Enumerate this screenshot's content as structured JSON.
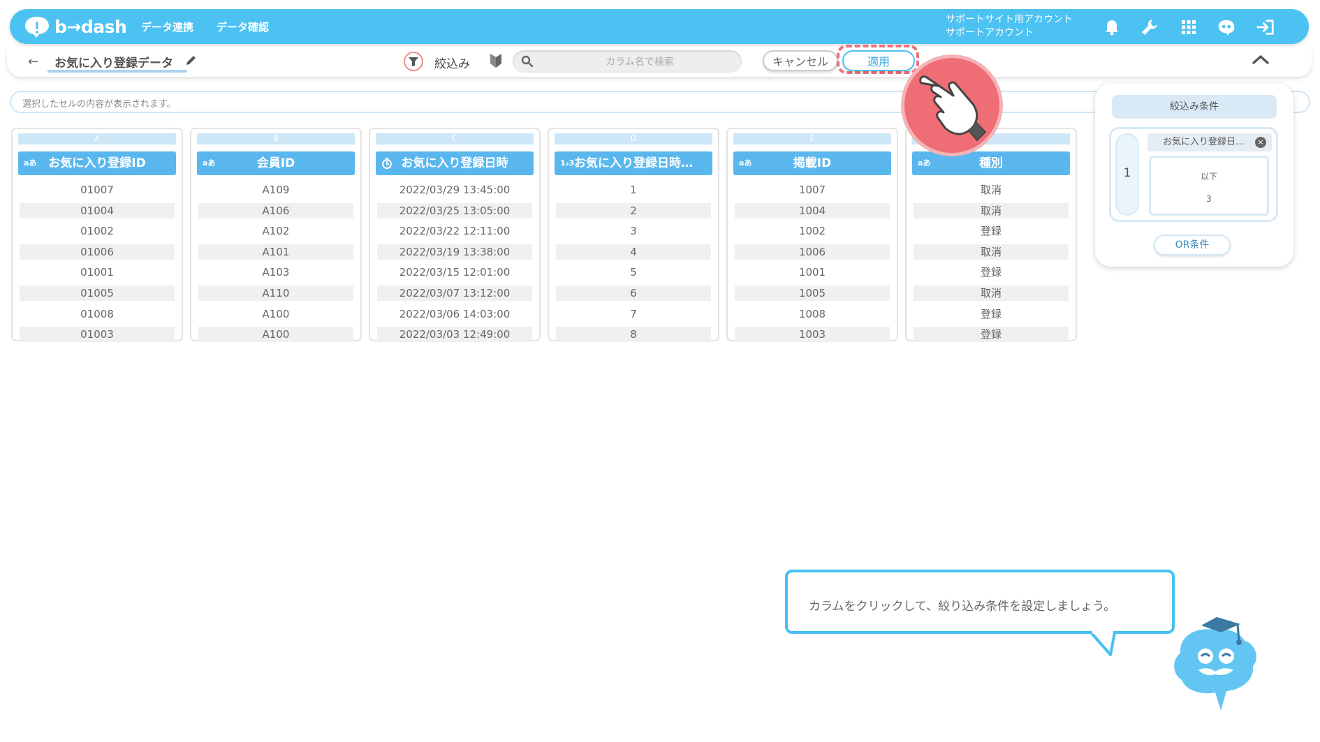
{
  "app": {
    "logo_text": "b→dash",
    "nav": [
      "データ連携",
      "データ確認"
    ],
    "account": {
      "line1": "サポートサイト用アカウント",
      "line2": "サポートアカウント"
    }
  },
  "toolbar": {
    "back_label": "←",
    "datasource_name": "お気に入り登録データ",
    "filter_label": "絞込み",
    "search_placeholder": "カラム名で検索",
    "cancel_label": "キャンセル",
    "apply_label": "適用"
  },
  "cell_bar": {
    "placeholder": "選択したセルの内容が表示されます。"
  },
  "table": {
    "columns": [
      {
        "letter": "A",
        "type": "aあ",
        "name": "お気に入り登録ID",
        "cells": [
          "01007",
          "01004",
          "01002",
          "01006",
          "01001",
          "01005",
          "01008",
          "01003"
        ]
      },
      {
        "letter": "B",
        "type": "aあ",
        "name": "会員ID",
        "cells": [
          "A109",
          "A106",
          "A102",
          "A101",
          "A103",
          "A110",
          "A100",
          "A100"
        ]
      },
      {
        "letter": "C",
        "type": "clock",
        "name": "お気に入り登録日時",
        "cells": [
          "2022/03/29 13:45:00",
          "2022/03/25 13:05:00",
          "2022/03/22 12:11:00",
          "2022/03/19 13:38:00",
          "2022/03/15 12:01:00",
          "2022/03/07 13:12:00",
          "2022/03/06 14:03:00",
          "2022/03/03 12:49:00"
        ]
      },
      {
        "letter": "D",
        "type": "1₂3",
        "name": "お気に入り登録日時…",
        "cells": [
          "1",
          "2",
          "3",
          "4",
          "5",
          "6",
          "7",
          "8"
        ]
      },
      {
        "letter": "E",
        "type": "aあ",
        "name": "掲載ID",
        "cells": [
          "1007",
          "1004",
          "1002",
          "1006",
          "1001",
          "1005",
          "1008",
          "1003"
        ]
      },
      {
        "letter": "F",
        "type": "aあ",
        "name": "種別",
        "cells": [
          "取消",
          "取消",
          "登録",
          "取消",
          "登録",
          "取消",
          "登録",
          "登録"
        ]
      }
    ]
  },
  "filter_panel": {
    "title": "絞込み条件",
    "group_number": "1",
    "field": "お気に入り登録日…",
    "operator": "以下",
    "value": "3",
    "or_button": "OR条件"
  },
  "tooltip": {
    "text": "カラムをクリックして、絞り込み条件を設定しましょう。"
  },
  "colors": {
    "accent": "#4cc2f3",
    "header": "#5ab7ee",
    "highlight": "#ef6d75"
  }
}
